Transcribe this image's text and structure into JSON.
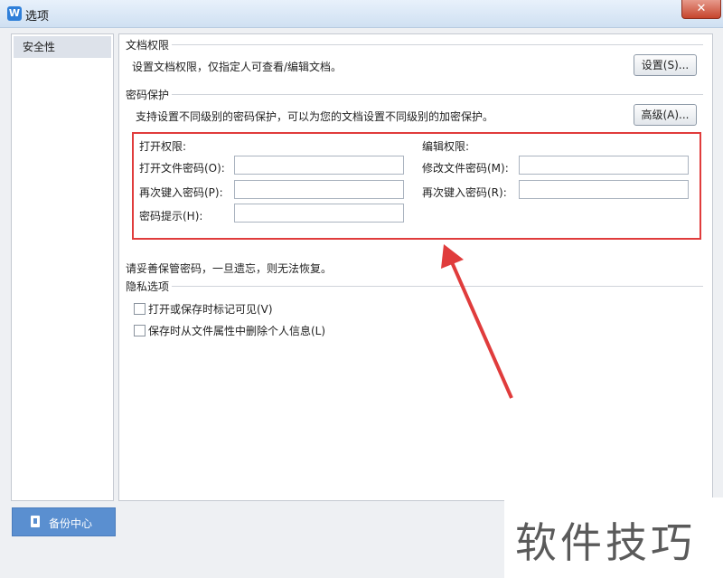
{
  "window": {
    "title": "选项",
    "app_icon": "wps-writer-icon",
    "close_label": "✕"
  },
  "sidebar": {
    "items": [
      {
        "label": "安全性",
        "selected": true
      }
    ]
  },
  "doc_permission": {
    "section_title": "文档权限",
    "description": "设置文档权限，仅指定人可查看/编辑文档。",
    "settings_button": "设置(S)..."
  },
  "password_protect": {
    "section_title": "密码保护",
    "description": "支持设置不同级别的密码保护，可以为您的文档设置不同级别的加密保护。",
    "advanced_button": "高级(A)...",
    "open_permission": {
      "heading": "打开权限:",
      "open_password_label": "打开文件密码(O):",
      "open_password_value": "",
      "reenter_label": "再次键入密码(P):",
      "reenter_value": "",
      "hint_label": "密码提示(H):",
      "hint_value": ""
    },
    "edit_permission": {
      "heading": "编辑权限:",
      "modify_password_label": "修改文件密码(M):",
      "modify_password_value": "",
      "reenter_label": "再次键入密码(R):",
      "reenter_value": ""
    },
    "warning": "请妥善保管密码，一旦遗忘，则无法恢复。"
  },
  "privacy": {
    "section_title": "隐私选项",
    "options": [
      {
        "label": "打开或保存时标记可见(V)",
        "checked": false
      },
      {
        "label": "保存时从文件属性中删除个人信息(L)",
        "checked": false
      }
    ]
  },
  "backup_button": "备份中心",
  "watermark": "软件技巧",
  "colors": {
    "highlight_box": "#e03c3c",
    "backup_button": "#5a8fd0",
    "annotation_arrow": "#e03c3c"
  }
}
